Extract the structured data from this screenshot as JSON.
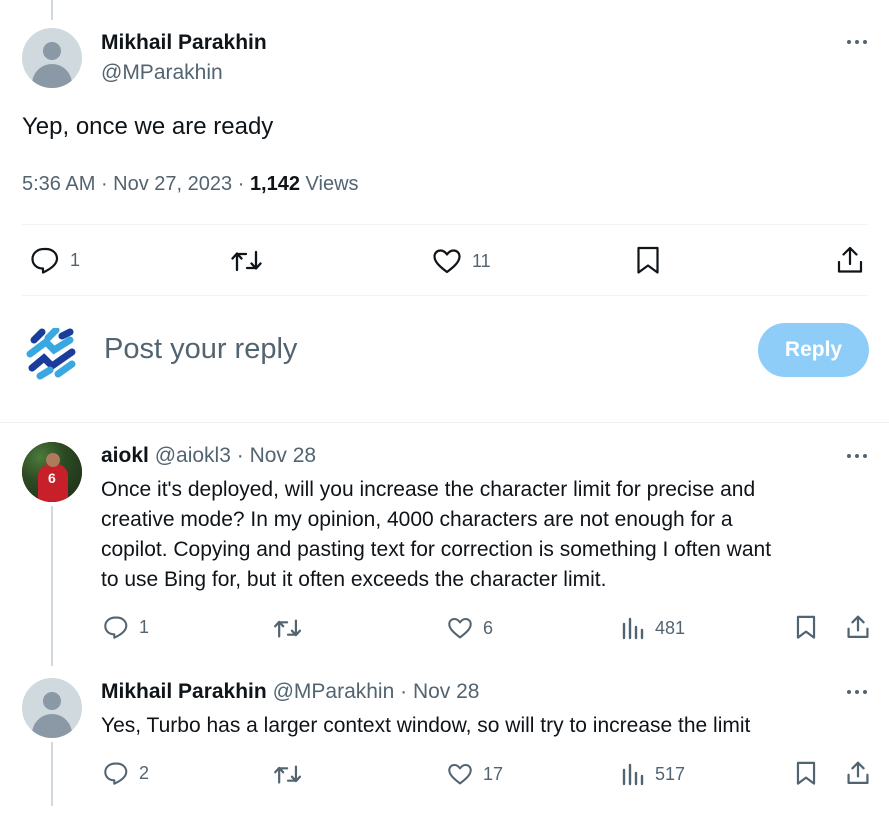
{
  "main_tweet": {
    "author_name": "Mikhail Parakhin",
    "author_handle": "@MParakhin",
    "text": "Yep, once we are ready",
    "time": "5:36 AM",
    "sep1": " · ",
    "date": "Nov 27, 2023",
    "sep2": " · ",
    "views_count": "1,142",
    "views_label": " Views",
    "replies": "1",
    "likes": "11"
  },
  "composer": {
    "placeholder": "Post your reply",
    "reply_button": "Reply"
  },
  "replies": [
    {
      "author_name": "aiokl",
      "author_handle": "@aiokl3",
      "sep": " · ",
      "date": "Nov 28",
      "avatar_number": "6",
      "lines": [
        "Once it's deployed, will you increase the character limit for precise and",
        "creative mode? In my opinion, 4000 characters are not enough for a",
        "copilot. Copying and pasting text for correction is something I often want",
        "to use Bing for, but it often exceeds the character limit."
      ],
      "replies": "1",
      "likes": "6",
      "views": "481"
    },
    {
      "author_name": "Mikhail Parakhin",
      "author_handle": "@MParakhin",
      "sep": " · ",
      "date": "Nov 28",
      "lines": [
        "Yes, Turbo has a larger context window, so will try to increase the limit"
      ],
      "replies": "2",
      "likes": "17",
      "views": "517"
    }
  ],
  "colors": {
    "text": "#0f1419",
    "secondary": "#536471",
    "reply_button_bg": "#8ecdf8",
    "divider": "#eff3f4",
    "logo_dark": "#1a3d9c",
    "logo_light": "#39a8e0"
  },
  "icons": [
    "reply-icon",
    "retweet-icon",
    "like-icon",
    "bookmark-icon",
    "share-icon",
    "views-icon",
    "more-icon"
  ]
}
